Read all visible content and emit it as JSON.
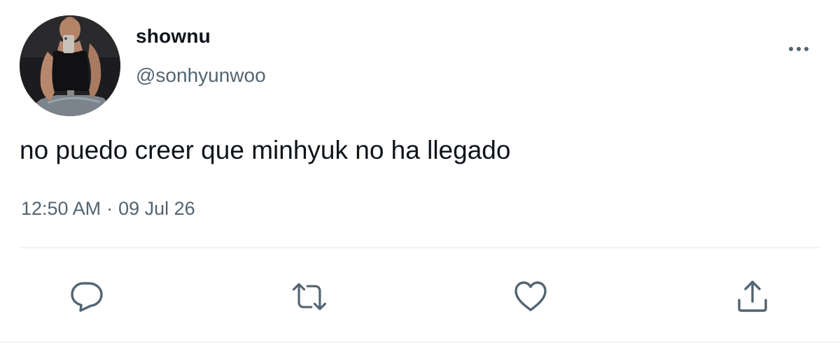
{
  "user": {
    "display_name": "shownu",
    "handle": "@sonhyunwoo"
  },
  "tweet": {
    "text": "no puedo creer que minhyuk no ha llegado",
    "time": "12:50 AM",
    "separator": "·",
    "date": "09 Jul 26"
  },
  "actions": {
    "reply_icon": "reply-icon",
    "retweet_icon": "retweet-icon",
    "like_icon": "heart-icon",
    "share_icon": "share-icon",
    "more_icon": "more-icon"
  },
  "colors": {
    "text_primary": "#0f1419",
    "text_secondary": "#536471",
    "icon": "#536471",
    "divider": "#eff3f4"
  }
}
